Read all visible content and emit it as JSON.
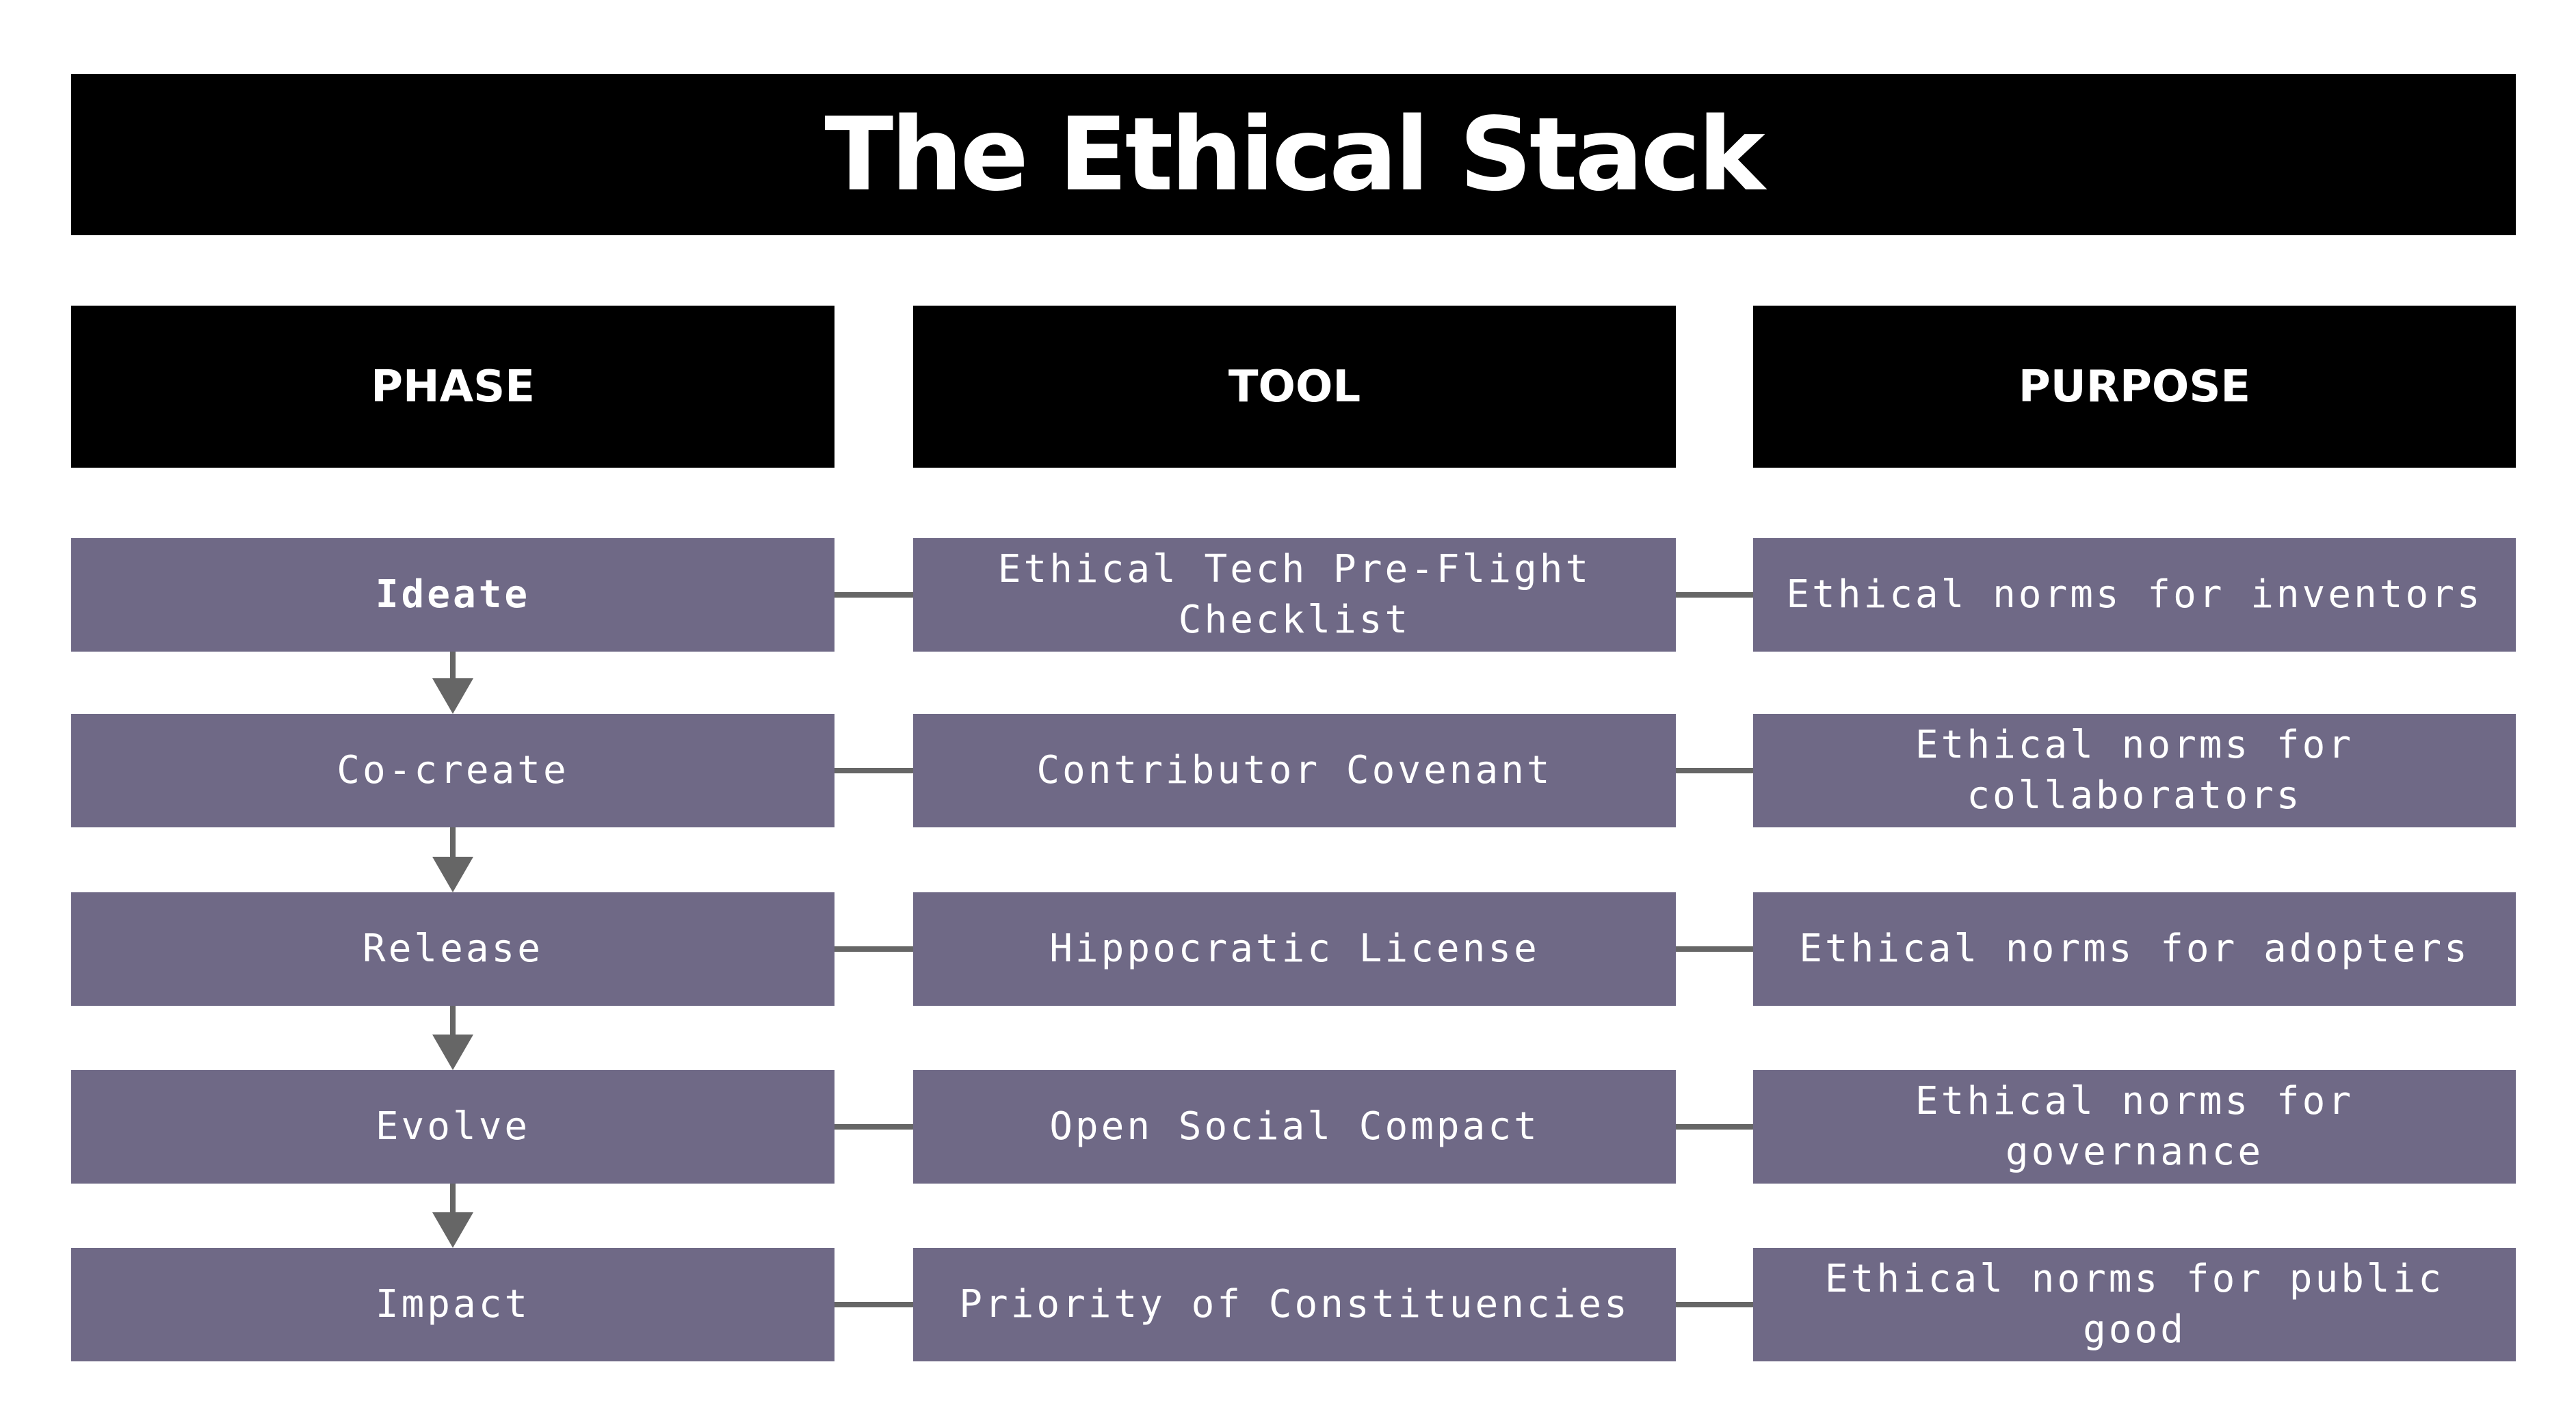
{
  "title": "The Ethical Stack",
  "headers": {
    "phase": "PHASE",
    "tool": "TOOL",
    "purpose": "PURPOSE"
  },
  "rows": [
    {
      "phase": "Ideate",
      "tool": "Ethical Tech Pre-Flight Checklist",
      "purpose": "Ethical norms for inventors"
    },
    {
      "phase": "Co-create",
      "tool": "Contributor Covenant",
      "purpose": "Ethical norms for collaborators"
    },
    {
      "phase": "Release",
      "tool": "Hippocratic License",
      "purpose": "Ethical norms for adopters"
    },
    {
      "phase": "Evolve",
      "tool": "Open Social Compact",
      "purpose": "Ethical norms for governance"
    },
    {
      "phase": "Impact",
      "tool": "Priority of Constituencies",
      "purpose": "Ethical norms for public good"
    }
  ],
  "colors": {
    "header_bg": "#000000",
    "cell_bg": "#6f6986",
    "connector": "#666666",
    "text": "#ffffff"
  }
}
